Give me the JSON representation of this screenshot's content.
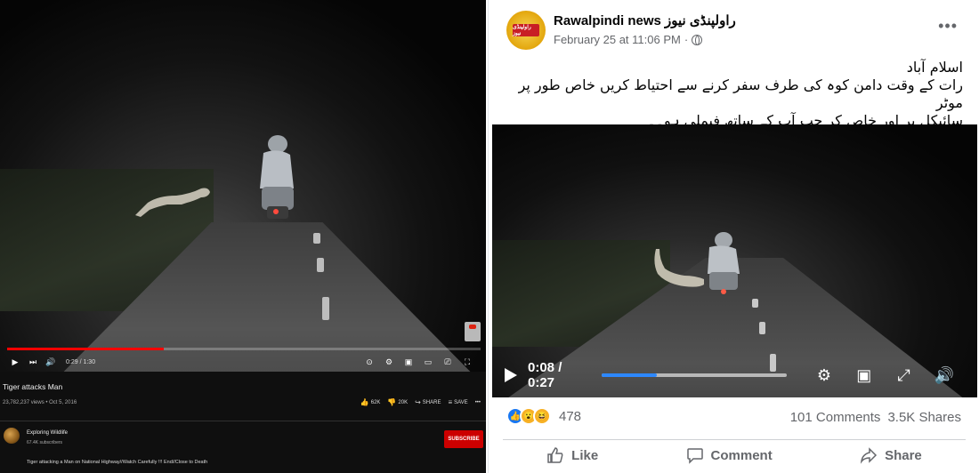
{
  "youtube": {
    "time_display": "0:29 / 1:30",
    "progress_fraction": 0.33,
    "title": "Tiger attacks Man",
    "views": "23,782,237 views • Oct 5, 2016",
    "likes": "62K",
    "dislikes": "20K",
    "share_label": "SHARE",
    "save_label": "SAVE",
    "more_label": "•••",
    "channel_name": "Exploring Wildlife",
    "subscribers": "67.4K subscribers",
    "subscribe_label": "SUBSCRIBE",
    "description": "Tiger attacking a Man on National Highway//Watch Carefully !!! End//Close to Death",
    "colors": {
      "progress": "#ff0000",
      "subscribe": "#cc0000"
    }
  },
  "facebook": {
    "page_name": "Rawalpindi news راولپنڈی نیوز",
    "avatar_badge": "راولپنڈی نیوز",
    "timestamp": "February 25 at 11:06 PM",
    "timestamp_separator": "·",
    "more_icon": "•••",
    "post_lines": [
      "اسلام آباد",
      "رات کے وقت دامن کوہ کی طرف سفر کرنے سے احتیاط کریں خاص طور پر موٹر",
      "سائیکل پر اور خاص کر جب آپ کے ساتھ فیملی ہو۔۔"
    ],
    "video_time": "0:08 / 0:27",
    "video_progress_fraction": 0.3,
    "reaction_count": "478",
    "comments": "101 Comments",
    "shares": "3.5K Shares",
    "like_label": "Like",
    "comment_label": "Comment",
    "share_label": "Share",
    "colors": {
      "accent": "#1877f2",
      "progress": "#2d88ff",
      "muted": "#65676b"
    }
  }
}
